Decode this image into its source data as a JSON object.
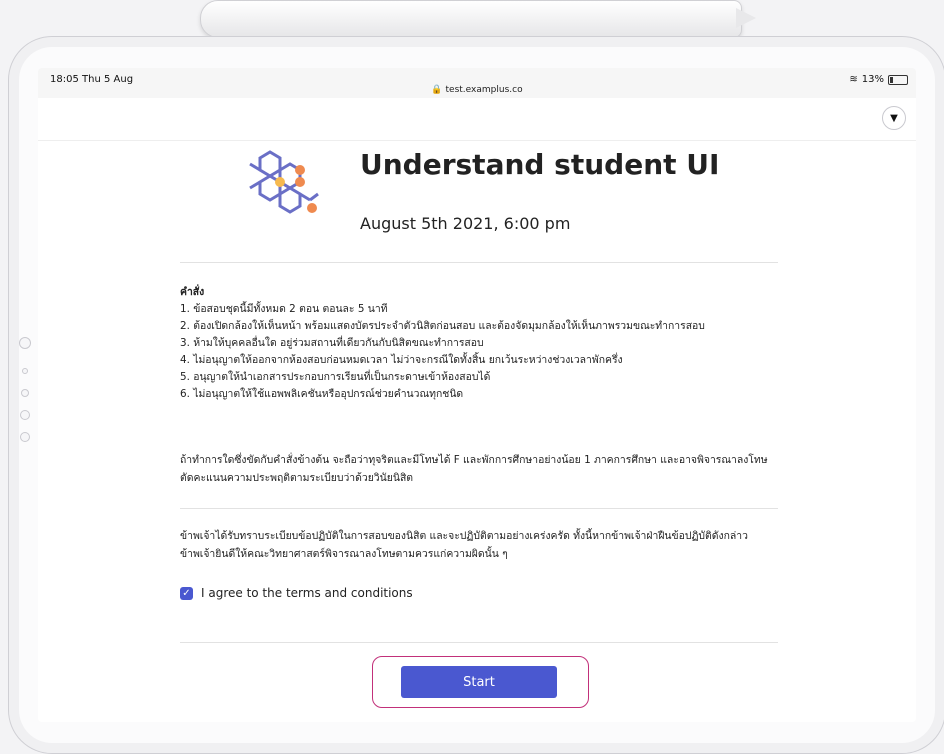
{
  "status_bar": {
    "time": "18:05",
    "day": "Thu 5 Aug",
    "url": "test.examplus.co",
    "battery": "13%"
  },
  "exam": {
    "title": "Understand student UI",
    "datetime": "August 5th 2021, 6:00 pm"
  },
  "instructions": {
    "heading": "คำสั่ง",
    "items": [
      "1. ข้อสอบชุดนี้มีทั้งหมด 2 ตอน ตอนละ 5 นาที",
      "2. ต้องเปิดกล้องให้เห็นหน้า พร้อมแสดงบัตรประจำตัวนิสิตก่อนสอบ และต้องจัดมุมกล้องให้เห็นภาพรวมขณะทำการสอบ",
      "3. ห้ามให้บุคคลอื่นใด อยู่ร่วมสถานที่เดียวกันกับนิสิตขณะทำการสอบ",
      "4. ไม่อนุญาตให้ออกจากห้องสอบก่อนหมดเวลา ไม่ว่าจะกรณีใดทั้งสิ้น ยกเว้นระหว่างช่วงเวลาพักครึ่ง",
      "5. อนุญาตให้นำเอกสารประกอบการเรียนที่เป็นกระดาษเข้าห้องสอบได้",
      "6. ไม่อนุญาตให้ใช้แอพพลิเคชันหรืออุปกรณ์ช่วยคำนวณทุกชนิด"
    ],
    "warning": "ถ้าทำการใดซึ่งขัดกับคำสั่งข้างต้น จะถือว่าทุจริตและมีโทษได้ F และพักการศึกษาอย่างน้อย 1 ภาคการศึกษา และอาจพิจารณาลงโทษตัดคะแนนความประพฤติตามระเบียบว่าด้วยวินัยนิสิต"
  },
  "pledge": "ข้าพเจ้าได้รับทราบระเบียบข้อปฏิบัติในการสอบของนิสิต และจะปฏิบัติตามอย่างเคร่งครัด ทั้งนี้หากข้าพเจ้าฝ่าฝืนข้อปฏิบัติดังกล่าว ข้าพเจ้ายินดีให้คณะวิทยาศาสตร์พิจารณาลงโทษตามควรแก่ความผิดนั้น ๆ",
  "agree": {
    "label": "I agree to the terms and conditions",
    "checked": true
  },
  "start_button": {
    "label": "Start"
  },
  "colors": {
    "accent": "#4a58d0",
    "highlight": "#c2307a",
    "logo_blue": "#6a6fc6",
    "logo_orange": "#ef8a4f"
  }
}
